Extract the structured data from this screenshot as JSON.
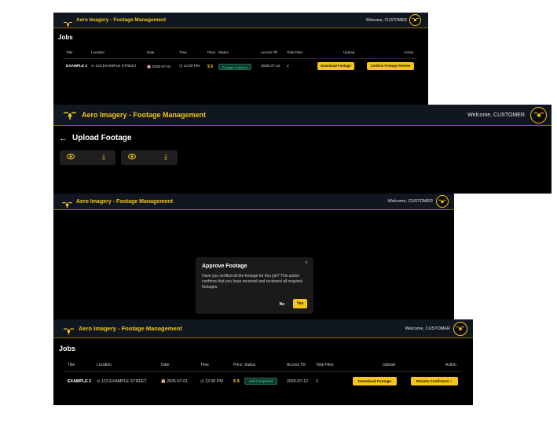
{
  "brand_title": "Aero Imagery - Footage Management",
  "welcome": "Welcome, CUSTOMER",
  "jobs_panel_1": {
    "heading": "Jobs",
    "columns": [
      "Title",
      "Location",
      "Date",
      "Time",
      "Price",
      "Status",
      "Access Till",
      "Total Files",
      "Upload",
      "Action"
    ],
    "row": {
      "title": "EXAMPLE 2",
      "location": "123 EXAMPLE STREET",
      "date": "2025-07-01",
      "time": "12:00 PM",
      "price": "$ $",
      "status": "Footage Captured",
      "access_till": "2025-07-12",
      "total_files": "2",
      "upload_button": "Download Footage",
      "action_button": "Confirm Footage Review"
    }
  },
  "upload_panel": {
    "heading": "Upload Footage",
    "back_icon": "arrow-left-icon",
    "tiles": [
      {
        "view_icon": "eye-icon",
        "download_icon": "download-icon"
      },
      {
        "view_icon": "eye-icon",
        "download_icon": "download-icon"
      }
    ]
  },
  "modal_panel": {
    "title": "Approve Footage",
    "body": "Have you verified all the footage for this job? This action confirms that you have received and reviewed all required footages.",
    "close_glyph": "×",
    "no_label": "No",
    "yes_label": "Yes"
  },
  "jobs_panel_2": {
    "heading": "Jobs",
    "columns": [
      "Title",
      "Location",
      "Date",
      "Time",
      "Price",
      "Status",
      "Access Till",
      "Total Files",
      "Upload",
      "Action"
    ],
    "row": {
      "title": "EXAMPLE 2",
      "location": "123 EXAMPLE STREET",
      "date": "2025-07-01",
      "time": "12:00 PM",
      "price": "$ $",
      "status": "Job Completed",
      "access_till": "2025-07-12",
      "total_files": "2",
      "upload_button": "Download Footage",
      "action_button": "Review Confirmed ✓"
    }
  },
  "glyphs": {
    "calendar": "📅",
    "clock": "◷",
    "pin": "⊙",
    "eye": "👁",
    "download": "⤓",
    "back": "←"
  },
  "colors": {
    "accent": "#f5c518",
    "header_bg": "#101720",
    "panel_bg": "#000000",
    "status_green": "#3ddc97"
  }
}
